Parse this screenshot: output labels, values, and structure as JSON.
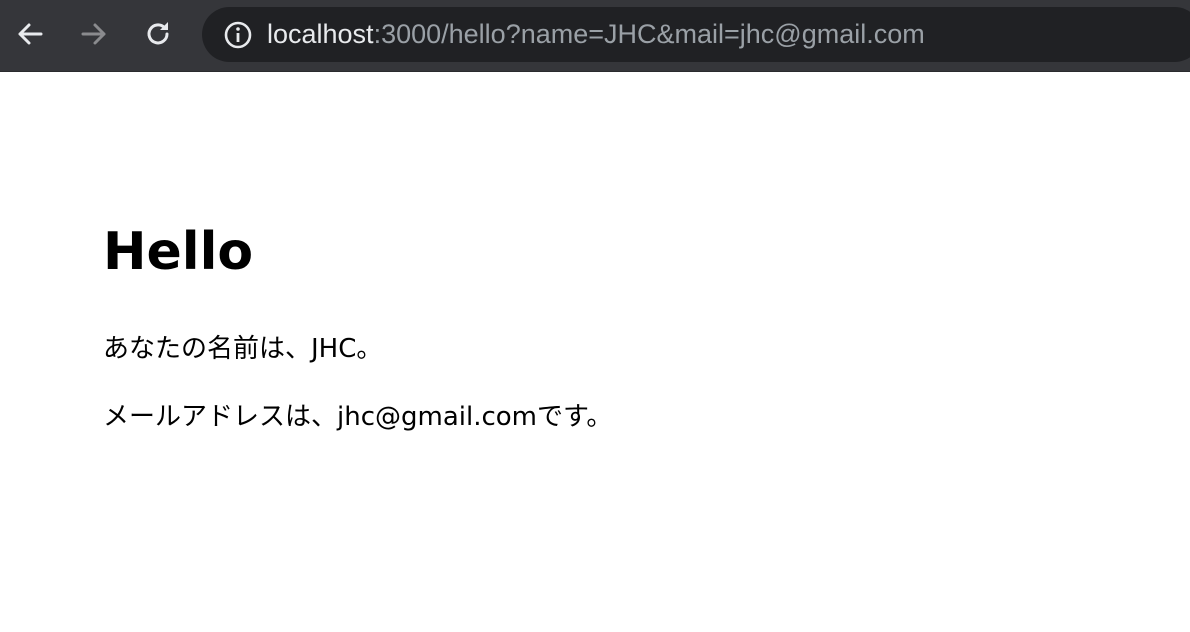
{
  "browser": {
    "url_host": "localhost",
    "url_rest": ":3000/hello?name=JHC&mail=jhc@gmail.com",
    "icons": [
      "back-arrow-icon",
      "forward-arrow-icon",
      "reload-icon",
      "info-icon"
    ]
  },
  "page": {
    "title": "Hello",
    "name_line": "あなたの名前は、JHC。",
    "mail_line": "メールアドレスは、jhc@gmail.comです。"
  }
}
